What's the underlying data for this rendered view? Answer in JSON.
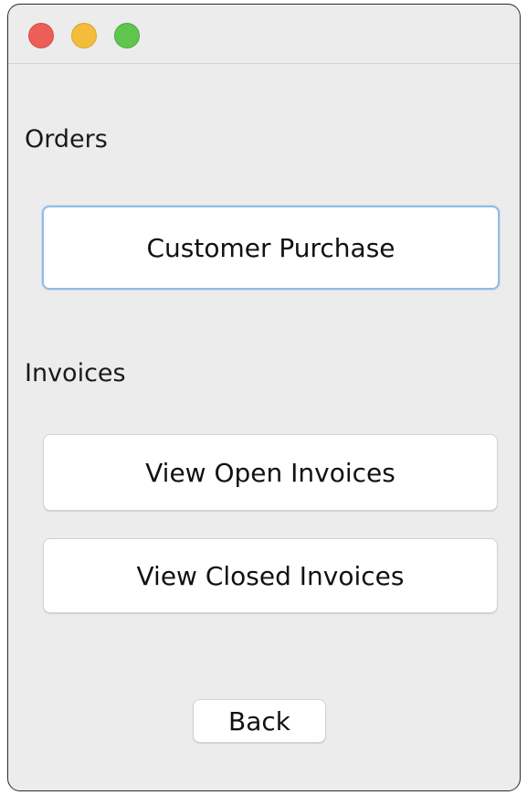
{
  "window": {
    "controls": [
      "close",
      "minimize",
      "zoom"
    ]
  },
  "orders": {
    "label": "Orders",
    "customer_purchase_label": "Customer Purchase"
  },
  "invoices": {
    "label": "Invoices",
    "view_open_label": "View Open Invoices",
    "view_closed_label": "View Closed Invoices"
  },
  "footer": {
    "back_label": "Back"
  },
  "colors": {
    "window_bg": "#ececec",
    "close": "#ec5f58",
    "minimize": "#f3bc3c",
    "zoom": "#5fc54d",
    "focus_ring": "#93bbea"
  }
}
